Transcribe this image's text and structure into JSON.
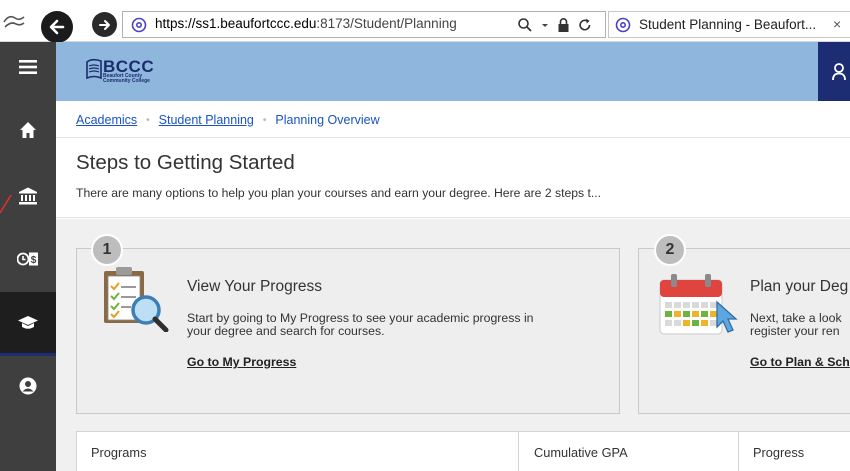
{
  "browser": {
    "url_host": "https://ss1.beaufortccc.edu",
    "url_rest": ":8173/Student/Planning",
    "tab_title": "Student Planning - Beaufort...",
    "tab_close": "×",
    "icons": [
      "edge-logo-icon",
      "back-icon",
      "forward-icon",
      "search-icon",
      "dropdown-icon",
      "lock-icon",
      "refresh-icon"
    ]
  },
  "header": {
    "logo_main": "BCCC",
    "logo_sub_1": "Beaufort County",
    "logo_sub_2": "Community College"
  },
  "breadcrumb": {
    "items": [
      "Academics",
      "Student Planning",
      "Planning Overview"
    ],
    "separator": "•"
  },
  "steps": {
    "title": "Steps to Getting Started",
    "subtitle": "There are many options to help you plan your courses and earn your degree. Here are 2 steps t..."
  },
  "cards": [
    {
      "number": "1",
      "title": "View Your Progress",
      "desc_line1": "Start by going to My Progress to see your academic progress in",
      "desc_line2": "your degree and search for courses.",
      "link": "Go to My Progress"
    },
    {
      "number": "2",
      "title": "Plan your Deg",
      "desc_line1": "Next, take a look",
      "desc_line2": "register your ren",
      "link": "Go to Plan & Sch"
    }
  ],
  "table": {
    "columns": [
      "Programs",
      "Cumulative GPA",
      "Progress"
    ]
  },
  "colors": {
    "header_blue": "#8fb7dd",
    "navy": "#1c2d74",
    "link_blue": "#1a53c2",
    "nav_gray": "#3f3f3f"
  }
}
